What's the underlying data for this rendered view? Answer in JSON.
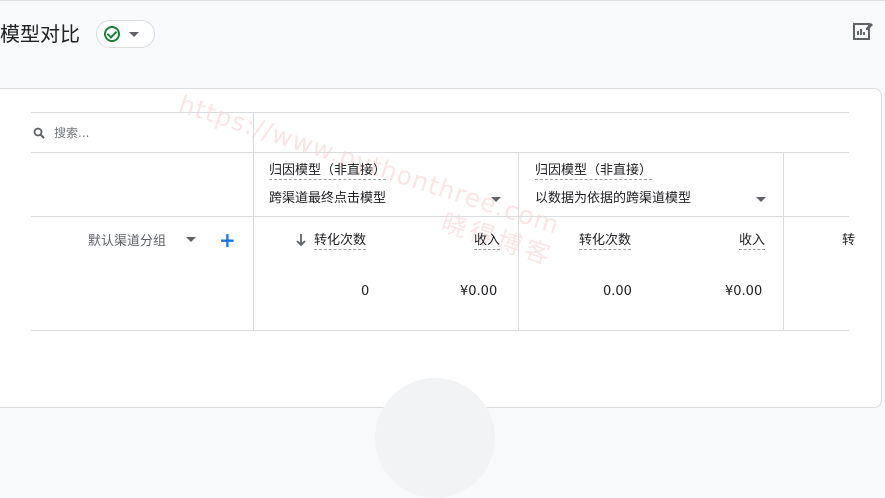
{
  "page": {
    "title": "模型对比",
    "status_icon": "check-circle-icon",
    "status_dropdown_icon": "chevron-down-icon",
    "edit_icon": "edit-report-icon"
  },
  "search": {
    "placeholder": "搜索..."
  },
  "dimension": {
    "label": "默认渠道分组"
  },
  "models": [
    {
      "header": "归因模型（非直接）",
      "name": "跨渠道最终点击模型",
      "metric_1": "转化次数",
      "metric_2": "收入",
      "value_1": "0",
      "value_2": "¥0.00",
      "sort_indicator": "↓"
    },
    {
      "header": "归因模型（非直接）",
      "name": "以数据为依据的跨渠道模型",
      "metric_1": "转化次数",
      "metric_2": "收入",
      "value_1": "0.00",
      "value_2": "¥0.00"
    }
  ],
  "partial_column_text": "转",
  "watermark": {
    "site": "https://www.pythonthree.com",
    "name": "晓得博客"
  },
  "colors": {
    "accent": "#1a73e8",
    "success": "#188038",
    "border": "#dadce0",
    "watermark": "#e67b7b"
  }
}
